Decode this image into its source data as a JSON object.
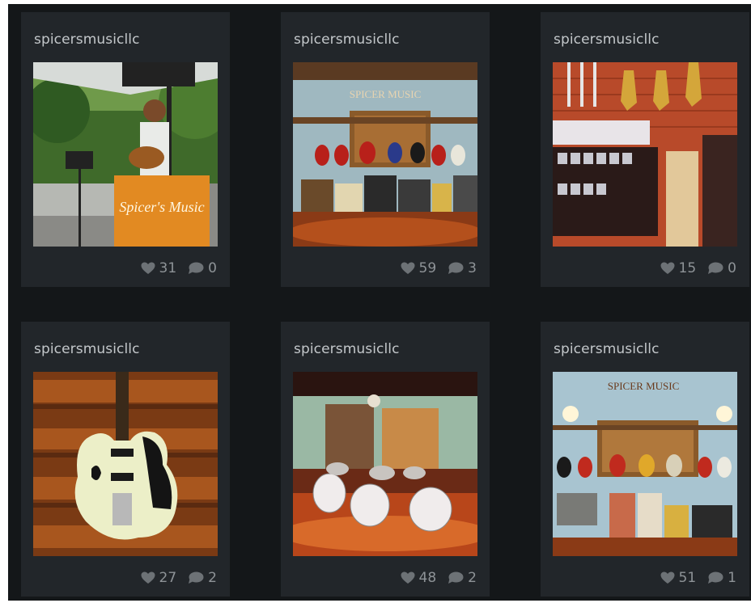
{
  "feed": {
    "posts": [
      {
        "username": "spicersmusicllc",
        "likes": "31",
        "comments": "0",
        "photo": "outdoor-performer"
      },
      {
        "username": "spicersmusicllc",
        "likes": "59",
        "comments": "3",
        "photo": "guitar-wall-amps"
      },
      {
        "username": "spicersmusicllc",
        "likes": "15",
        "comments": "0",
        "photo": "saxophones-accessories"
      },
      {
        "username": "spicersmusicllc",
        "likes": "27",
        "comments": "2",
        "photo": "white-electric-guitar"
      },
      {
        "username": "spicersmusicllc",
        "likes": "48",
        "comments": "2",
        "photo": "drum-kits-showroom"
      },
      {
        "username": "spicersmusicllc",
        "likes": "51",
        "comments": "1",
        "photo": "storefront-guitar-wall"
      }
    ]
  },
  "photo_text": {
    "banner": "Spicer's Music",
    "sign": "SPICER MUSIC"
  },
  "icons": {
    "like": "heart-icon",
    "comment": "speech-bubble-icon"
  },
  "colors": {
    "background": "#141719",
    "card": "#22262a",
    "username": "#c3c7ca",
    "stat": "#8e9397"
  }
}
